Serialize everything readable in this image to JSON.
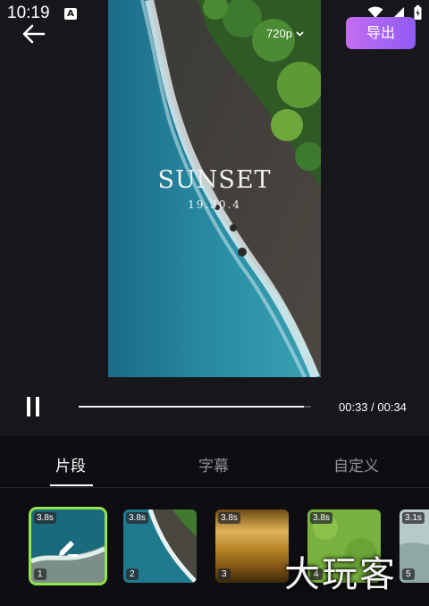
{
  "status_bar": {
    "time": "10:19",
    "indicator": "A"
  },
  "header": {
    "resolution": "720p",
    "export_label": "导出"
  },
  "video": {
    "title": "SUNSET",
    "subtitle": "19.30.4"
  },
  "playback": {
    "time_display": "00:33 / 00:34",
    "progress": 0.97
  },
  "tabs": [
    {
      "label": "片段",
      "active": true
    },
    {
      "label": "字幕",
      "active": false
    },
    {
      "label": "自定义",
      "active": false
    }
  ],
  "clips": [
    {
      "duration": "3.8s",
      "index": "1",
      "selected": true
    },
    {
      "duration": "3.8s",
      "index": "2",
      "selected": false
    },
    {
      "duration": "3.8s",
      "index": "3",
      "selected": false
    },
    {
      "duration": "3.8s",
      "index": "4",
      "selected": false
    },
    {
      "duration": "3.1s",
      "index": "5",
      "selected": false
    }
  ],
  "watermark": "大玩客",
  "colors": {
    "accent": "#9b5cf5",
    "selected_clip": "#93e54a"
  }
}
